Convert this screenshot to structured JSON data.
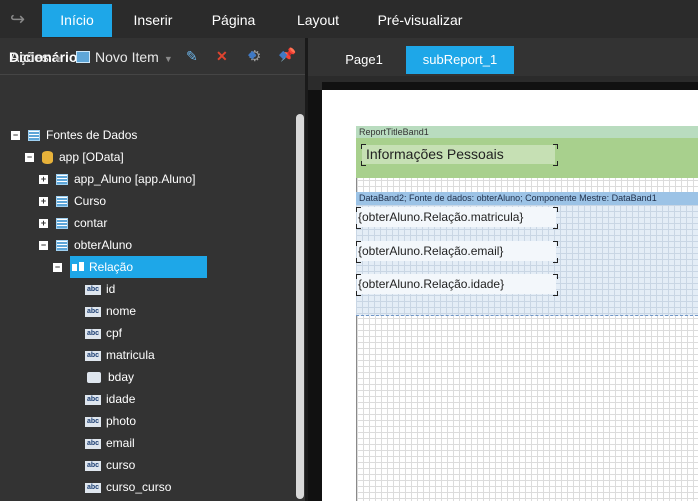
{
  "menu": {
    "tabs": [
      "Início",
      "Inserir",
      "Página",
      "Layout",
      "Pré-visualizar"
    ],
    "active_tab": "Início"
  },
  "dictionary": {
    "title": "Dicionário",
    "actions_label": "Ações",
    "new_item_label": "Novo Item",
    "tree": {
      "root": "Fontes de Dados",
      "datasource": "app [OData]",
      "tables": [
        "app_Aluno [app.Aluno]",
        "Curso",
        "contar",
        "obterAluno"
      ],
      "relation": "Relação",
      "fields": [
        "id",
        "nome",
        "cpf",
        "matricula",
        "bday",
        "idade",
        "photo",
        "email",
        "curso",
        "curso_curso"
      ],
      "field_type_label": "abc"
    }
  },
  "pages": {
    "tabs": [
      "Page1",
      "subReport_1"
    ],
    "active": "subReport_1"
  },
  "report": {
    "title_band_name": "ReportTitleBand1",
    "title_text": "Informações Pessoais",
    "data_band_name": "DataBand2; Fonte de dados: obterAluno; Componente Mestre: DataBand1",
    "data_fields": [
      "{obterAluno.Relação.matricula}",
      "{obterAluno.Relação.email}",
      "{obterAluno.Relação.idade}"
    ]
  },
  "colors": {
    "accent": "#1ea7e8",
    "title_band": "#a8d08d",
    "data_band_header": "#9cc3e6"
  }
}
